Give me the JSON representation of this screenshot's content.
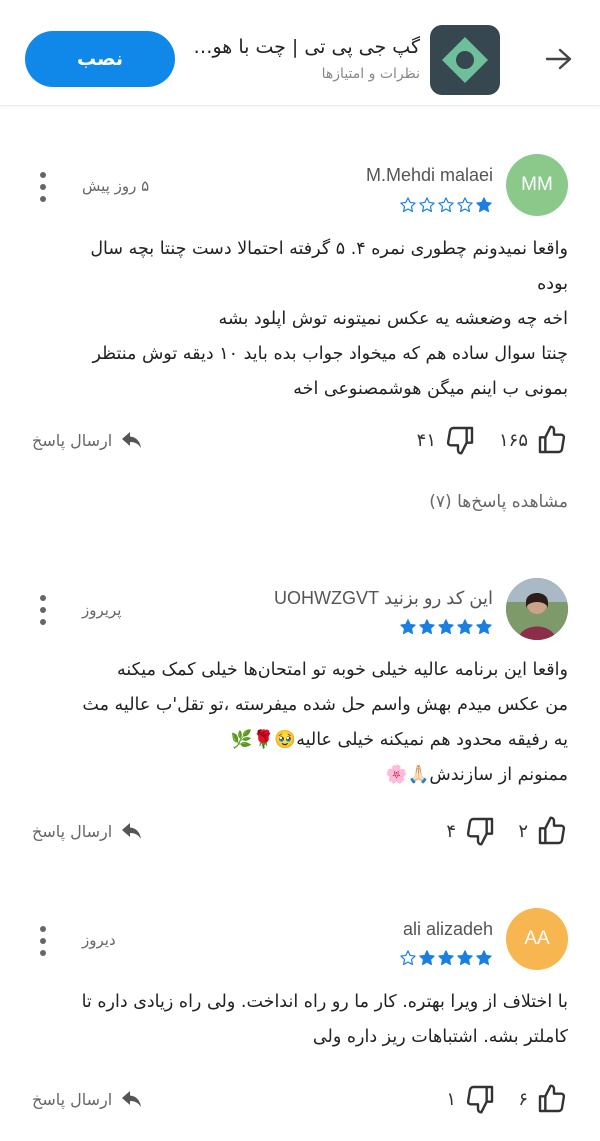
{
  "header": {
    "title": "گپ جی پی تی | چت با هو…",
    "subtitle": "نظرات و امتیازها",
    "install_label": "نصب"
  },
  "reviews": [
    {
      "author": "M.Mehdi malaei",
      "avatar_initials": "MM",
      "avatar_color": "#8bc98a",
      "date": "۵ روز پیش",
      "rating": 1,
      "lines": [
        "واقعا نمیدونم چطوری نمره ۴. ۵ گرفته احتمالا دست چنتا بچه سال",
        "بوده",
        "اخه چه وضعشه یه عکس نمیتونه توش اپلود بشه",
        "چنتا سوال ساده هم که میخواد جواب بده باید ۱۰ دیقه توش منتظر",
        "بمونی ب اینم میگن هوشمصنوعی اخه"
      ],
      "likes": "۱۶۵",
      "dislikes": "۴۱",
      "reply_label": "ارسال پاسخ",
      "view_replies": "مشاهده پاسخ‌ها (۷)"
    },
    {
      "author": "این کد رو بزنید UOHWZGVT",
      "avatar_initials": "",
      "avatar_color": "#6f8f5c",
      "date": "پریروز",
      "rating": 5,
      "lines": [
        "واقعا این برنامه عالیه خیلی خوبه تو امتحان‌ها خیلی کمک میکنه",
        "من عکس میدم بهش واسم حل شده میفرسته ،تو تقل'ب عالیه مث",
        "یه رفیقه محدود هم نمیکنه خیلی عالیه🥹🌹🌿",
        "ممنونم از سازندش🙏🏻🌸"
      ],
      "likes": "۲",
      "dislikes": "۴",
      "reply_label": "ارسال پاسخ"
    },
    {
      "author": "ali alizadeh",
      "avatar_initials": "AA",
      "avatar_color": "#f7b64f",
      "date": "دیروز",
      "rating": 4,
      "lines": [
        "با اختلاف از ویرا بهتره. کار ما رو راه انداخت. ولی راه زیادی داره تا",
        "کاملتر بشه. اشتباهات ریز داره ولی"
      ],
      "likes": "۶",
      "dislikes": "۱",
      "reply_label": "ارسال پاسخ"
    }
  ],
  "colors": {
    "accent": "#1088ea",
    "star": "#1a7fe0"
  }
}
